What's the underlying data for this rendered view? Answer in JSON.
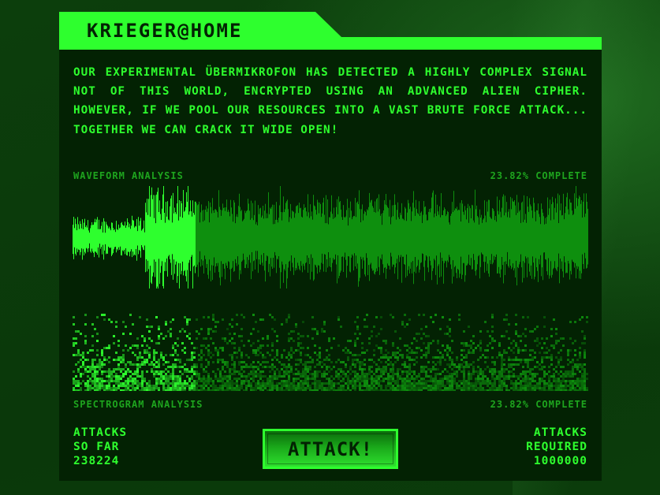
{
  "app": {
    "title": "KRIEGER@HOME"
  },
  "intro": {
    "text": "OUR EXPERIMENTAL ÜBERMIKROFON HAS DETECTED A HIGHLY COMPLEX SIGNAL NOT OF THIS WORLD, ENCRYPTED USING AN ADVANCED ALIEN CIPHER. HOWEVER, IF WE POOL OUR RESOURCES INTO A VAST BRUTE FORCE ATTACK... TOGETHER WE CAN CRACK IT WIDE OPEN!"
  },
  "waveform": {
    "label": "WAVEFORM ANALYSIS",
    "status": "23.82% COMPLETE",
    "progress": 0.2382
  },
  "spectrogram": {
    "label": "SPECTROGRAM ANALYSIS",
    "status": "23.82% COMPLETE",
    "progress": 0.2382
  },
  "stats": {
    "attacks_so_far_line1": "ATTACKS",
    "attacks_so_far_line2": "SO FAR",
    "attacks_so_far_value": "238224",
    "attacks_required_line1": "ATTACKS",
    "attacks_required_line2": "REQUIRED",
    "attacks_required_value": "1000000"
  },
  "actions": {
    "attack_label": "ATTACK!"
  },
  "colors": {
    "bright": "#2eff2e",
    "dim": "#0e8f0e",
    "panel": "#032203",
    "background": "#0a3a0a"
  }
}
